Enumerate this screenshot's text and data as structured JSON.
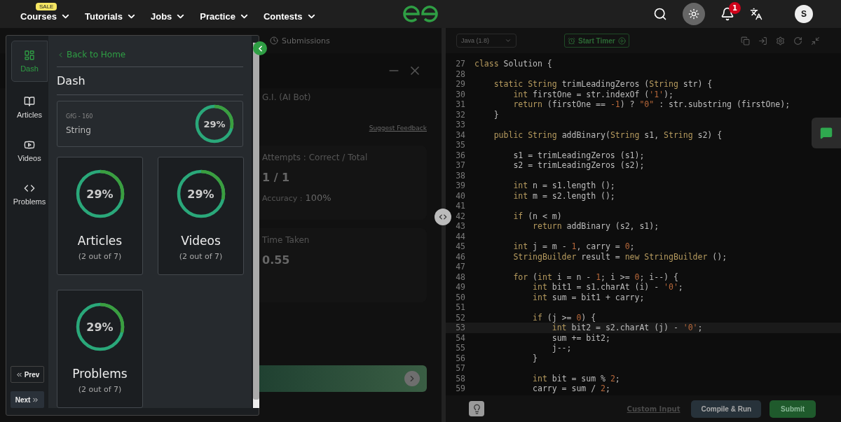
{
  "nav": {
    "items": [
      {
        "label": "Courses",
        "badge": "SALE"
      },
      {
        "label": "Tutorials"
      },
      {
        "label": "Jobs"
      },
      {
        "label": "Practice"
      },
      {
        "label": "Contests"
      }
    ],
    "notifications": "1",
    "avatar": "S"
  },
  "problem_pane": {
    "tab": "Submissions",
    "ai_bot": "G.I. (AI Bot)",
    "feedback_link": "Suggest Feedback",
    "attempts": {
      "label": "Attempts : Correct / Total",
      "value": "1 / 1",
      "accuracy_label": "Accuracy :",
      "accuracy_value": "100%"
    },
    "time": {
      "label": "Time Taken",
      "value": "0.55"
    }
  },
  "dashboard": {
    "rail": [
      {
        "label": "Dash",
        "selected": true
      },
      {
        "label": "Articles",
        "selected": false
      },
      {
        "label": "Videos",
        "selected": false
      },
      {
        "label": "Problems",
        "selected": false
      }
    ],
    "prev": "Prev",
    "next": "Next",
    "back_link": "Back to Home",
    "title": "Dash",
    "topic": {
      "code": "GfG - 160",
      "name": "String",
      "reading": "29%",
      "level": 0.29
    },
    "cards": [
      {
        "title": "Articles",
        "reading": "29%",
        "level": 0.29,
        "detail": "(2 out of 7)"
      },
      {
        "title": "Videos",
        "reading": "29%",
        "level": 0.29,
        "detail": "(2 out of 7)"
      },
      {
        "title": "Problems",
        "reading": "29%",
        "level": 0.29,
        "detail": "(2 out of 7)"
      }
    ]
  },
  "editor": {
    "language": "Java (1.8)",
    "timer": "Start Timer",
    "lines": [
      {
        "number": "27",
        "active": false,
        "tokens": [
          {
            "kind": "keyword",
            "text": "class"
          },
          {
            "kind": "plain",
            "text": " Solution {"
          }
        ]
      },
      {
        "number": "28",
        "active": false
      },
      {
        "number": "29",
        "active": false,
        "tokens": [
          {
            "kind": "keyword",
            "text": "    static String"
          },
          {
            "kind": "plain",
            "text": " trimLeadingZeros ("
          },
          {
            "kind": "keyword",
            "text": "String"
          },
          {
            "kind": "plain",
            "text": " str) {"
          }
        ]
      },
      {
        "number": "30",
        "active": false,
        "tokens": [
          {
            "kind": "keyword",
            "text": "        int"
          },
          {
            "kind": "plain",
            "text": " firstOne = str.indexOf ("
          },
          {
            "kind": "number",
            "text": "'1'"
          },
          {
            "kind": "plain",
            "text": ");"
          }
        ]
      },
      {
        "number": "31",
        "active": false,
        "tokens": [
          {
            "kind": "keyword",
            "text": "        return"
          },
          {
            "kind": "plain",
            "text": " (firstOne == "
          },
          {
            "kind": "number",
            "text": "-1"
          },
          {
            "kind": "plain",
            "text": ") ? "
          },
          {
            "kind": "number",
            "text": "\"0\""
          },
          {
            "kind": "plain",
            "text": " : str.substring (firstOne);"
          }
        ]
      },
      {
        "number": "32",
        "active": false,
        "tokens": [
          {
            "kind": "plain",
            "text": "    }"
          }
        ]
      },
      {
        "number": "33",
        "active": false
      },
      {
        "number": "34",
        "active": false,
        "tokens": [
          {
            "kind": "keyword",
            "text": "    public String"
          },
          {
            "kind": "plain",
            "text": " addBinary("
          },
          {
            "kind": "keyword",
            "text": "String"
          },
          {
            "kind": "plain",
            "text": " s1, "
          },
          {
            "kind": "keyword",
            "text": "String"
          },
          {
            "kind": "plain",
            "text": " s2) {"
          }
        ]
      },
      {
        "number": "35",
        "active": false
      },
      {
        "number": "36",
        "active": false,
        "tokens": [
          {
            "kind": "plain",
            "text": "        s1 = trimLeadingZeros (s1);"
          }
        ]
      },
      {
        "number": "37",
        "active": false,
        "tokens": [
          {
            "kind": "plain",
            "text": "        s2 = trimLeadingZeros (s2);"
          }
        ]
      },
      {
        "number": "38",
        "active": false
      },
      {
        "number": "39",
        "active": false,
        "tokens": [
          {
            "kind": "keyword",
            "text": "        int"
          },
          {
            "kind": "plain",
            "text": " n = s1.length ();"
          }
        ]
      },
      {
        "number": "40",
        "active": false,
        "tokens": [
          {
            "kind": "keyword",
            "text": "        int"
          },
          {
            "kind": "plain",
            "text": " m = s2.length ();"
          }
        ]
      },
      {
        "number": "41",
        "active": false
      },
      {
        "number": "42",
        "active": false,
        "tokens": [
          {
            "kind": "keyword",
            "text": "        if"
          },
          {
            "kind": "plain",
            "text": " (n < m)"
          }
        ]
      },
      {
        "number": "43",
        "active": false,
        "tokens": [
          {
            "kind": "keyword",
            "text": "            return"
          },
          {
            "kind": "plain",
            "text": " addBinary (s2, s1);"
          }
        ]
      },
      {
        "number": "44",
        "active": false
      },
      {
        "number": "45",
        "active": false,
        "tokens": [
          {
            "kind": "keyword",
            "text": "        int"
          },
          {
            "kind": "plain",
            "text": " j = m - "
          },
          {
            "kind": "number",
            "text": "1"
          },
          {
            "kind": "plain",
            "text": ", carry = "
          },
          {
            "kind": "number",
            "text": "0"
          },
          {
            "kind": "plain",
            "text": ";"
          }
        ]
      },
      {
        "number": "46",
        "active": false,
        "tokens": [
          {
            "kind": "keyword",
            "text": "        StringBuilder"
          },
          {
            "kind": "plain",
            "text": " result = "
          },
          {
            "kind": "keyword",
            "text": "new StringBuilder"
          },
          {
            "kind": "plain",
            "text": " ();"
          }
        ]
      },
      {
        "number": "47",
        "active": false
      },
      {
        "number": "48",
        "active": false,
        "tokens": [
          {
            "kind": "keyword",
            "text": "        for"
          },
          {
            "kind": "plain",
            "text": " ("
          },
          {
            "kind": "keyword",
            "text": "int"
          },
          {
            "kind": "plain",
            "text": " i = n - "
          },
          {
            "kind": "number",
            "text": "1"
          },
          {
            "kind": "plain",
            "text": "; i >= "
          },
          {
            "kind": "number",
            "text": "0"
          },
          {
            "kind": "plain",
            "text": "; i--) {"
          }
        ]
      },
      {
        "number": "49",
        "active": false,
        "tokens": [
          {
            "kind": "keyword",
            "text": "            int"
          },
          {
            "kind": "plain",
            "text": " bit1 = s1.charAt (i) - "
          },
          {
            "kind": "number",
            "text": "'0'"
          },
          {
            "kind": "plain",
            "text": ";"
          }
        ]
      },
      {
        "number": "50",
        "active": false,
        "tokens": [
          {
            "kind": "keyword",
            "text": "            int"
          },
          {
            "kind": "plain",
            "text": " sum = bit1 + carry;"
          }
        ]
      },
      {
        "number": "51",
        "active": false
      },
      {
        "number": "52",
        "active": false,
        "tokens": [
          {
            "kind": "keyword",
            "text": "            if"
          },
          {
            "kind": "plain",
            "text": " (j >= "
          },
          {
            "kind": "number",
            "text": "0"
          },
          {
            "kind": "plain",
            "text": ") {"
          }
        ]
      },
      {
        "number": "53",
        "active": true,
        "tokens": [
          {
            "kind": "keyword",
            "text": "                int"
          },
          {
            "kind": "plain",
            "text": " bit2 = s2.charAt (j) - "
          },
          {
            "kind": "number",
            "text": "'0'"
          },
          {
            "kind": "plain",
            "text": ";"
          }
        ]
      },
      {
        "number": "54",
        "active": false,
        "tokens": [
          {
            "kind": "plain",
            "text": "                sum += bit2;"
          }
        ]
      },
      {
        "number": "55",
        "active": false,
        "tokens": [
          {
            "kind": "plain",
            "text": "                j--;"
          }
        ]
      },
      {
        "number": "56",
        "active": false,
        "tokens": [
          {
            "kind": "plain",
            "text": "            }"
          }
        ]
      },
      {
        "number": "57",
        "active": false
      },
      {
        "number": "58",
        "active": false,
        "tokens": [
          {
            "kind": "keyword",
            "text": "            int"
          },
          {
            "kind": "plain",
            "text": " bit = sum % "
          },
          {
            "kind": "number",
            "text": "2"
          },
          {
            "kind": "plain",
            "text": ";"
          }
        ]
      },
      {
        "number": "59",
        "active": false,
        "tokens": [
          {
            "kind": "plain",
            "text": "            carry = sum / "
          },
          {
            "kind": "number",
            "text": "2"
          },
          {
            "kind": "plain",
            "text": ";"
          }
        ]
      }
    ],
    "custom_input": "Custom Input",
    "compile": "Compile & Run",
    "submit": "Submit"
  }
}
